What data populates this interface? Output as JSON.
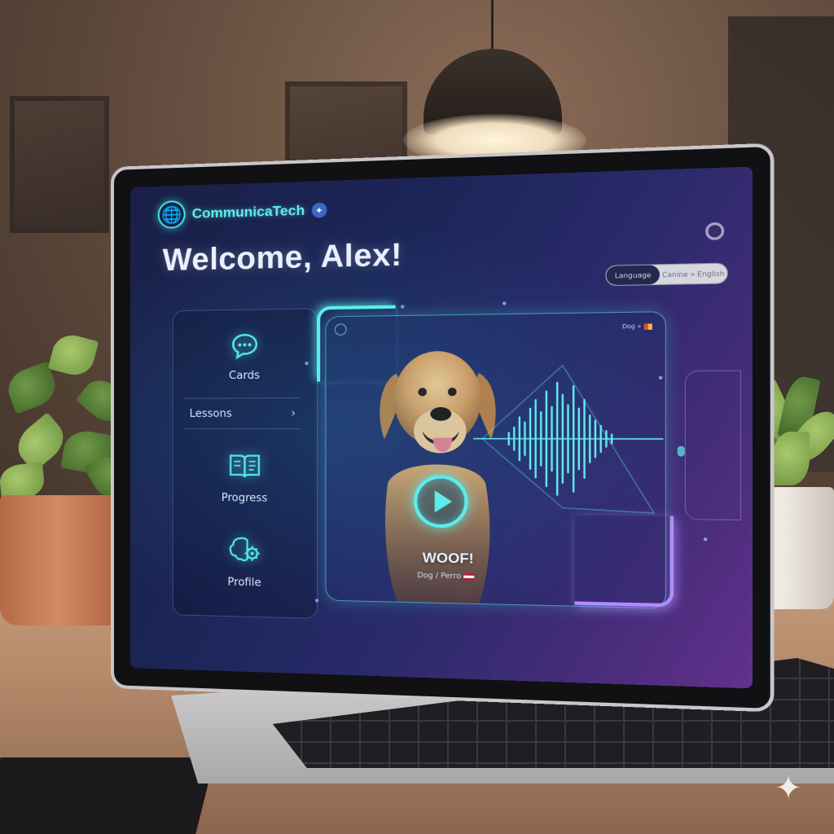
{
  "app": {
    "name": "CommunicaTech",
    "welcome": "Welcome, Alex!"
  },
  "language_selector": {
    "label": "Language",
    "value": "Canine » English"
  },
  "nav": {
    "cards": "Cards",
    "lessons": "Lessons",
    "progress": "Progress",
    "profile": "Profile"
  },
  "card": {
    "top_right_label": "Dog »",
    "word": "WOOF!",
    "translation": "Dog / Perro"
  },
  "colors": {
    "accent_cyan": "#5ff0ea",
    "accent_purple": "#b08cff",
    "screen_bg_start": "#1a2046",
    "screen_bg_end": "#63318c"
  },
  "icons": {
    "brand": "globe-icon",
    "cards": "chat-bubble-icon",
    "lessons": "chevron-right-icon",
    "progress": "open-book-icon",
    "profile": "brain-gear-icon",
    "play": "play-icon"
  }
}
